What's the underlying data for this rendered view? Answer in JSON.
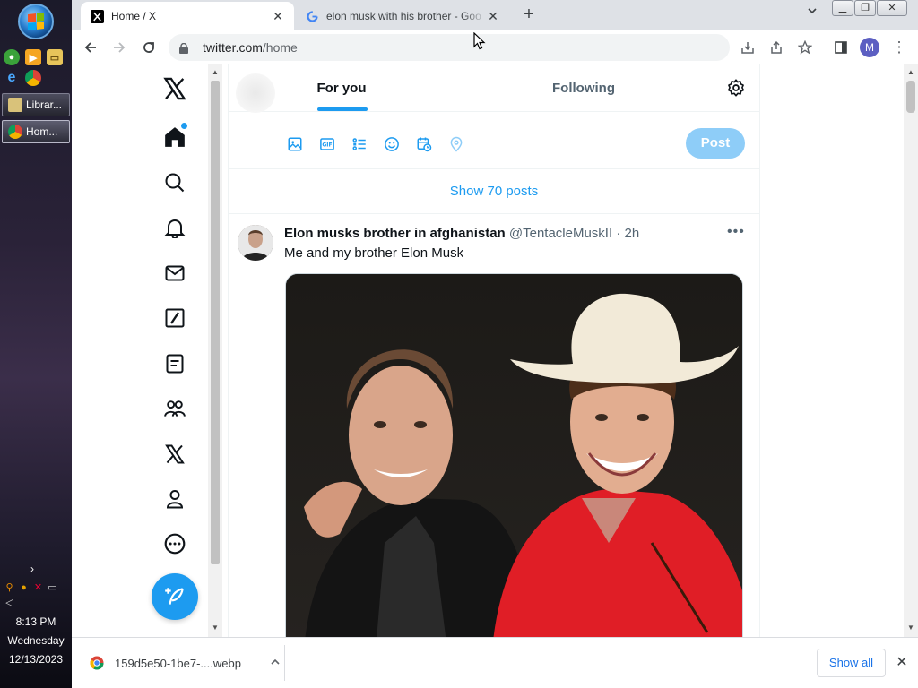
{
  "os": {
    "task_buttons": [
      {
        "label": "Librar..."
      },
      {
        "label": "Hom..."
      }
    ],
    "clock": {
      "time": "8:13 PM",
      "day": "Wednesday",
      "date": "12/13/2023"
    }
  },
  "browser": {
    "tabs": [
      {
        "title": "Home / X",
        "favicon": "x-logo-icon",
        "active": true
      },
      {
        "title": "elon musk with his brother - Goo",
        "favicon": "google-g-icon",
        "active": false
      }
    ],
    "new_tab": "+",
    "url": {
      "domain": "twitter.com",
      "path": "/home"
    },
    "profile_initial": "M"
  },
  "x": {
    "nav_items": [
      {
        "name": "home",
        "icon": "home-icon"
      },
      {
        "name": "explore",
        "icon": "search-icon"
      },
      {
        "name": "notifications",
        "icon": "bell-icon"
      },
      {
        "name": "messages",
        "icon": "mail-icon"
      },
      {
        "name": "grok",
        "icon": "slash-box-icon"
      },
      {
        "name": "lists",
        "icon": "list-icon"
      },
      {
        "name": "communities",
        "icon": "people-icon"
      },
      {
        "name": "premium",
        "icon": "x-logo-icon"
      },
      {
        "name": "profile",
        "icon": "person-icon"
      },
      {
        "name": "more",
        "icon": "more-circle-icon"
      }
    ],
    "accent_color": "#1d9bf0",
    "tabs": {
      "for_you": "For you",
      "following": "Following"
    },
    "post_button": "Post",
    "show_posts": "Show 70 posts",
    "tweet": {
      "name": "Elon musks brother in afghanistan",
      "handle": "@TentacleMuskII",
      "separator": " · ",
      "time": "2h",
      "text": "Me and my brother Elon Musk"
    }
  },
  "downloads": {
    "file_name": "159d5e50-1be7-....webp",
    "show_all": "Show all"
  }
}
